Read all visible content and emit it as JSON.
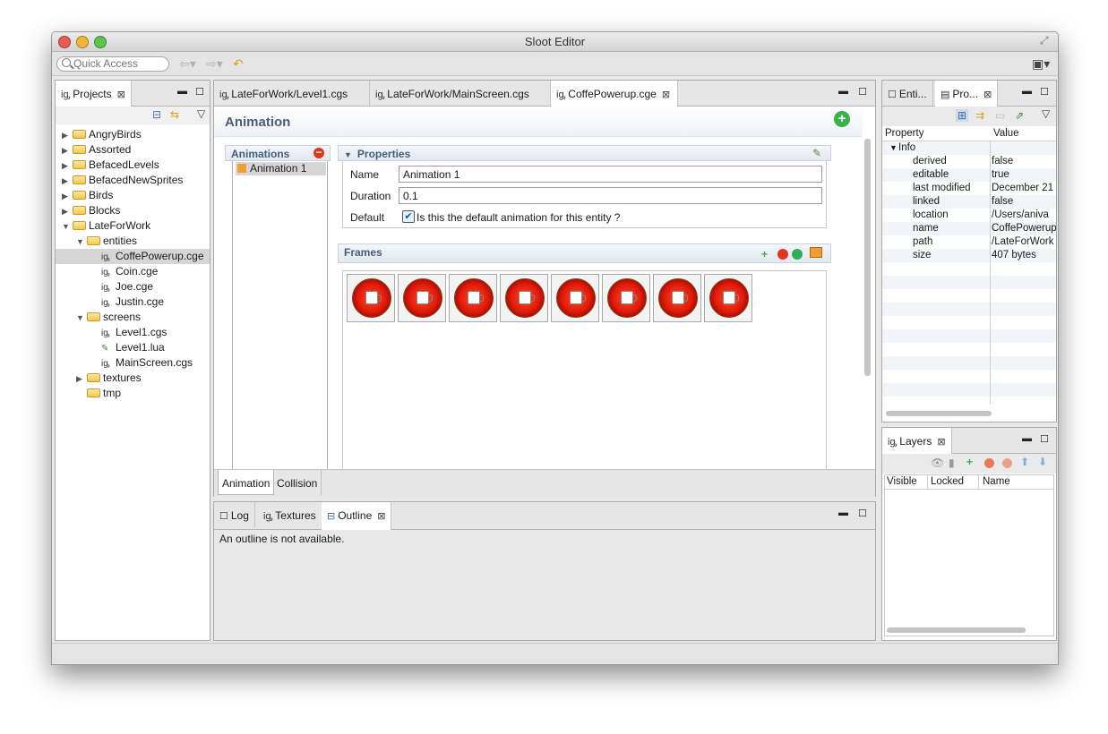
{
  "window": {
    "title": "Sloot Editor"
  },
  "toolbar": {
    "quick_access_placeholder": "Quick Access"
  },
  "projects": {
    "tab_label": "Projects",
    "tree": [
      {
        "label": "AngryBirds",
        "depth": 0,
        "kind": "folder",
        "expanded": false
      },
      {
        "label": "Assorted",
        "depth": 0,
        "kind": "folder",
        "expanded": false
      },
      {
        "label": "BefacedLevels",
        "depth": 0,
        "kind": "folder",
        "expanded": false
      },
      {
        "label": "BefacedNewSprites",
        "depth": 0,
        "kind": "folder",
        "expanded": false
      },
      {
        "label": "Birds",
        "depth": 0,
        "kind": "folder",
        "expanded": false
      },
      {
        "label": "Blocks",
        "depth": 0,
        "kind": "folder",
        "expanded": false
      },
      {
        "label": "LateForWork",
        "depth": 0,
        "kind": "folder",
        "expanded": true
      },
      {
        "label": "entities",
        "depth": 1,
        "kind": "folder",
        "expanded": true
      },
      {
        "label": "CoffePowerup.cge",
        "depth": 2,
        "kind": "file",
        "selected": true
      },
      {
        "label": "Coin.cge",
        "depth": 2,
        "kind": "file"
      },
      {
        "label": "Joe.cge",
        "depth": 2,
        "kind": "file"
      },
      {
        "label": "Justin.cge",
        "depth": 2,
        "kind": "file"
      },
      {
        "label": "screens",
        "depth": 1,
        "kind": "folder",
        "expanded": true
      },
      {
        "label": "Level1.cgs",
        "depth": 2,
        "kind": "file"
      },
      {
        "label": "Level1.lua",
        "depth": 2,
        "kind": "lua"
      },
      {
        "label": "MainScreen.cgs",
        "depth": 2,
        "kind": "file"
      },
      {
        "label": "textures",
        "depth": 1,
        "kind": "folder",
        "expanded": false
      },
      {
        "label": "tmp",
        "depth": 1,
        "kind": "folder-leaf"
      }
    ]
  },
  "editor": {
    "tabs": [
      {
        "label": "LateForWork/Level1.cgs",
        "active": false
      },
      {
        "label": "LateForWork/MainScreen.cgs",
        "active": false
      },
      {
        "label": "CoffePowerup.cge",
        "active": true
      }
    ],
    "heading": "Animation",
    "animations_label": "Animations",
    "animation_items": [
      "Animation 1"
    ],
    "properties_label": "Properties",
    "name_label": "Name",
    "name_value": "Animation 1",
    "duration_label": "Duration",
    "duration_value": "0.1",
    "default_label": "Default",
    "default_checkbox_label": "Is this the default animation for this entity ?",
    "default_checked": true,
    "frames_label": "Frames",
    "frame_count": 8,
    "bottom_tabs": [
      "Animation",
      "Collision"
    ]
  },
  "bottom_panel": {
    "tabs": [
      "Log",
      "Textures",
      "Outline"
    ],
    "message": "An outline is not available."
  },
  "properties_view": {
    "tabs": [
      "Enti...",
      "Pro..."
    ],
    "col_property": "Property",
    "col_value": "Value",
    "group": "Info",
    "rows": [
      {
        "key": "derived",
        "value": "false"
      },
      {
        "key": "editable",
        "value": "true"
      },
      {
        "key": "last modified",
        "value": "December 21"
      },
      {
        "key": "linked",
        "value": "false"
      },
      {
        "key": "location",
        "value": "/Users/aniva"
      },
      {
        "key": "name",
        "value": "CoffePowerup"
      },
      {
        "key": "path",
        "value": "/LateForWork"
      },
      {
        "key": "size",
        "value": "407  bytes"
      }
    ]
  },
  "layers": {
    "tab_label": "Layers",
    "col_visible": "Visible",
    "col_locked": "Locked",
    "col_name": "Name"
  }
}
